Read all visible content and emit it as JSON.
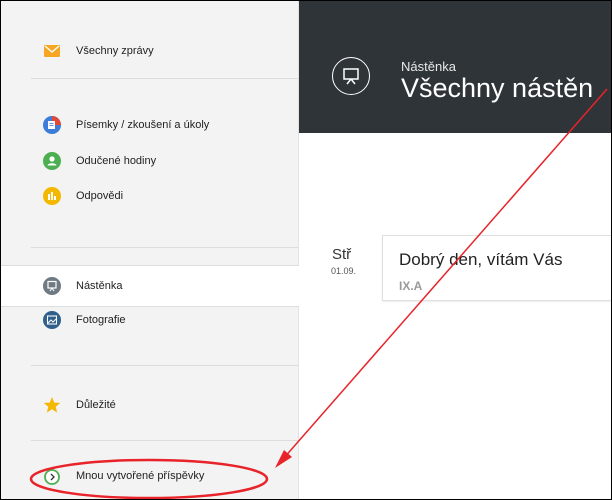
{
  "sidebar": {
    "items": [
      {
        "label": "Všechny zprávy",
        "icon": "mail-icon"
      },
      {
        "label": "Písemky / zkoušení a úkoly",
        "icon": "tasks-icon"
      },
      {
        "label": "Odučené hodiny",
        "icon": "lessons-icon"
      },
      {
        "label": "Odpovědi",
        "icon": "answers-icon"
      },
      {
        "label": "Nástěnka",
        "icon": "noticeboard-icon"
      },
      {
        "label": "Fotografie",
        "icon": "photos-icon"
      },
      {
        "label": "Důležité",
        "icon": "star-icon"
      },
      {
        "label": "Mnou vytvořené příspěvky",
        "icon": "my-posts-icon"
      }
    ],
    "active": "Nástěnka"
  },
  "header": {
    "subtitle": "Nástěnka",
    "title": "Všechny nástěn"
  },
  "post": {
    "day": "Stř",
    "date": "01.09.",
    "text": "Dobrý den, vítám Vás",
    "class": "IX.A"
  },
  "colors": {
    "header_bg": "#2f3439",
    "annotation": "#e8232a",
    "mail": "#f5a623",
    "tasks": "#3b7dd8",
    "lessons": "#4caf50",
    "answers": "#f5b800",
    "star": "#f5b800",
    "icon_dark": "#6f7a84"
  }
}
